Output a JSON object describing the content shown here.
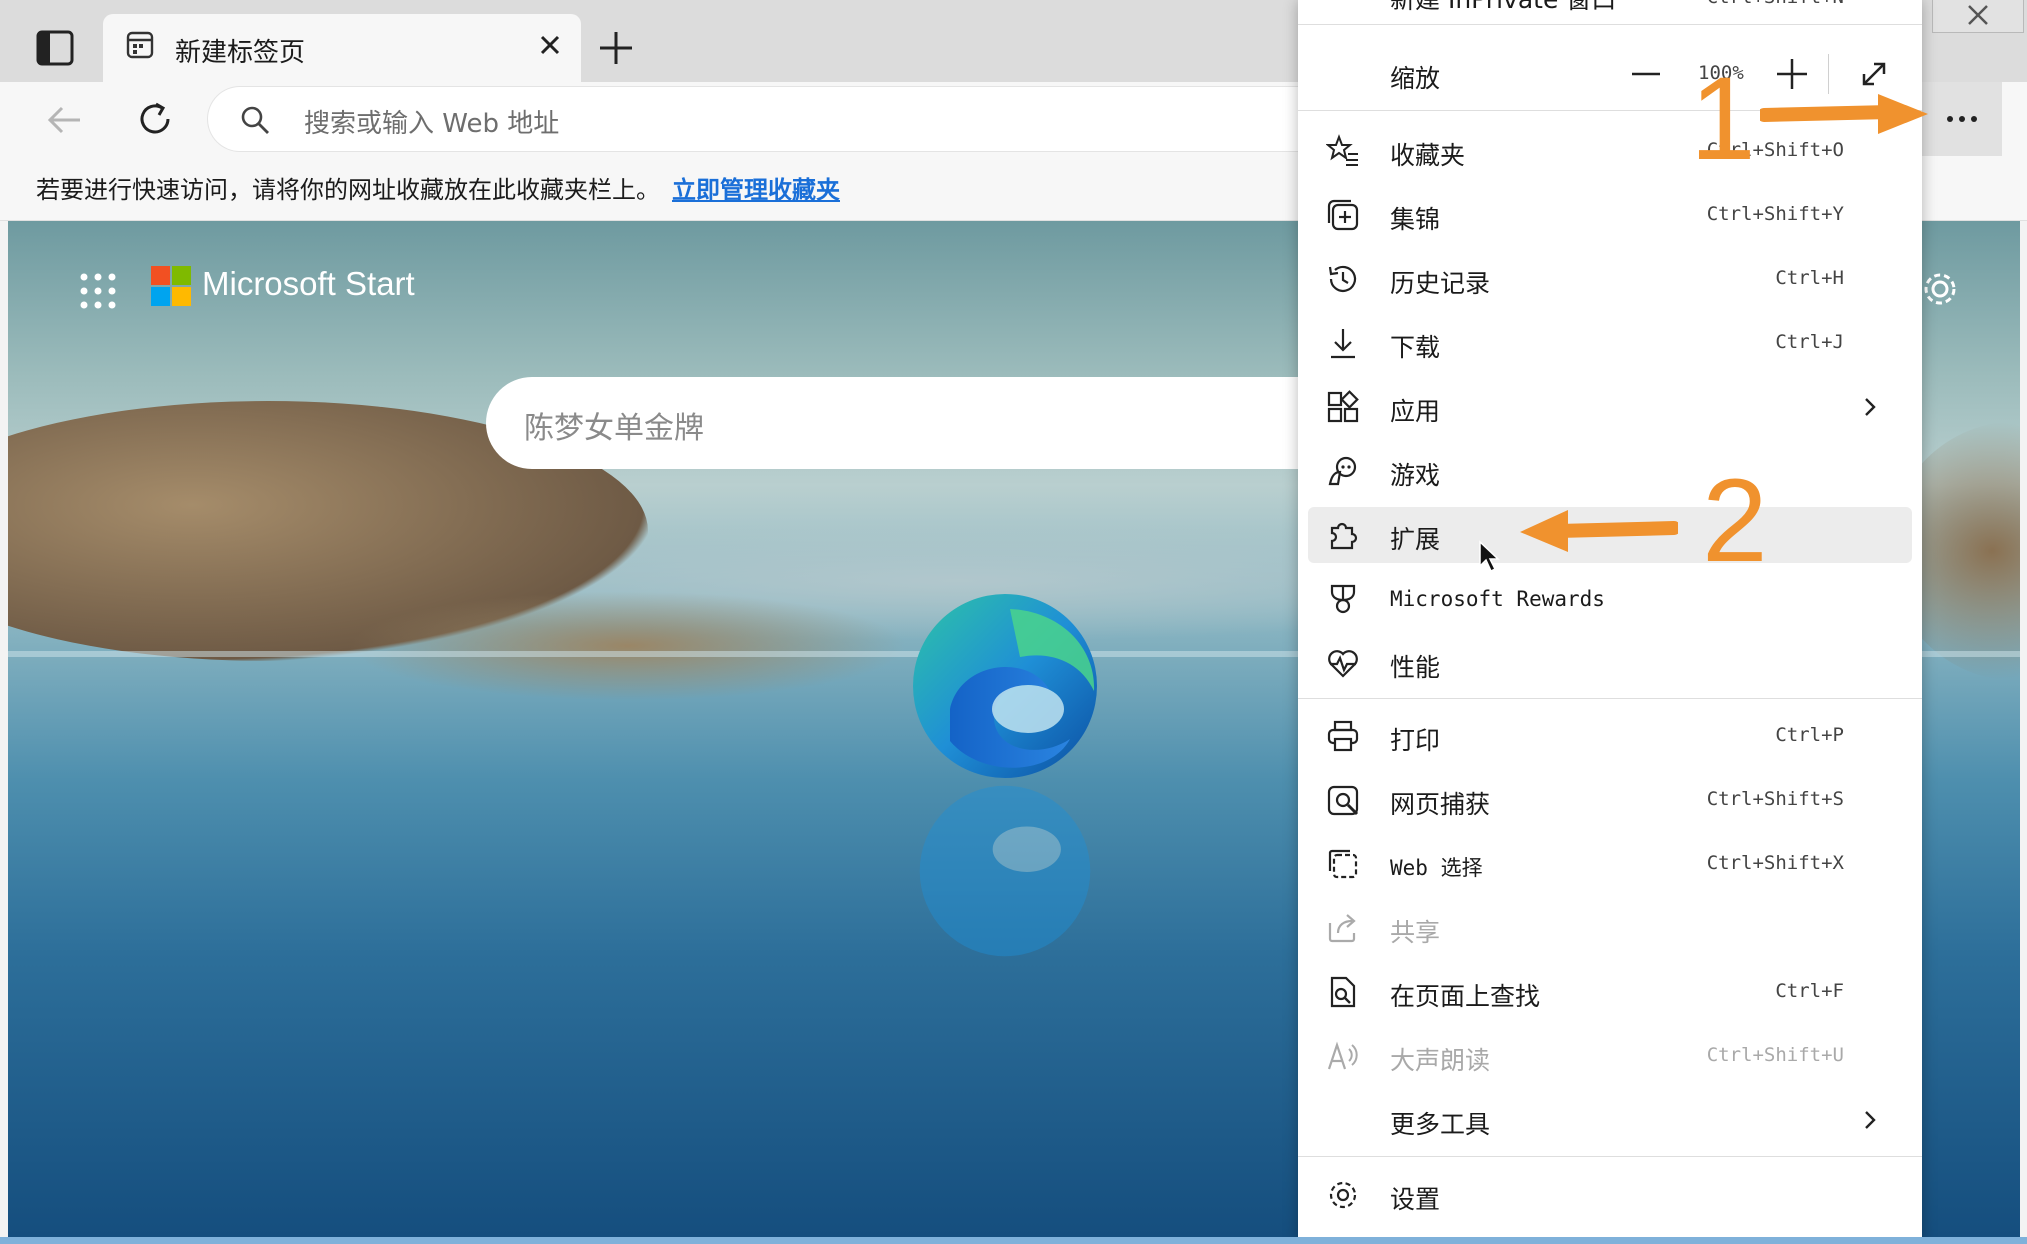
{
  "window": {
    "tab_title": "新建标签页"
  },
  "toolbar": {
    "address_placeholder": "搜索或输入 Web 地址"
  },
  "favorites_bar": {
    "hint": "若要进行快速访问，请将你的网址收藏放在此收藏夹栏上。",
    "manage_link": "立即管理收藏夹"
  },
  "new_tab_page": {
    "brand": "Microsoft Start",
    "search_placeholder": "陈梦女单金牌"
  },
  "menu": {
    "top_partial_label": "新建 InPrivate 窗口",
    "top_partial_shortcut": "Ctrl+Shift+N",
    "zoom": {
      "label": "缩放",
      "value": "100%"
    },
    "items": [
      {
        "label": "收藏夹",
        "shortcut": "Ctrl+Shift+O",
        "icon": "star-list-icon"
      },
      {
        "label": "集锦",
        "shortcut": "Ctrl+Shift+Y",
        "icon": "collections-icon"
      },
      {
        "label": "历史记录",
        "shortcut": "Ctrl+H",
        "icon": "history-icon"
      },
      {
        "label": "下载",
        "shortcut": "Ctrl+J",
        "icon": "download-icon"
      },
      {
        "label": "应用",
        "shortcut": "",
        "icon": "apps-icon",
        "submenu": true
      },
      {
        "label": "游戏",
        "shortcut": "",
        "icon": "games-icon"
      },
      {
        "label": "扩展",
        "shortcut": "",
        "icon": "extensions-icon",
        "highlighted": true
      },
      {
        "label": "Microsoft Rewards",
        "shortcut": "",
        "icon": "rewards-icon"
      },
      {
        "label": "性能",
        "shortcut": "",
        "icon": "performance-icon"
      },
      {
        "label": "打印",
        "shortcut": "Ctrl+P",
        "icon": "print-icon"
      },
      {
        "label": "网页捕获",
        "shortcut": "Ctrl+Shift+S",
        "icon": "web-capture-icon"
      },
      {
        "label": "Web 选择",
        "shortcut": "Ctrl+Shift+X",
        "icon": "web-select-icon"
      },
      {
        "label": "共享",
        "shortcut": "",
        "icon": "share-icon",
        "disabled": true
      },
      {
        "label": "在页面上查找",
        "shortcut": "Ctrl+F",
        "icon": "find-icon"
      },
      {
        "label": "大声朗读",
        "shortcut": "Ctrl+Shift+U",
        "icon": "read-aloud-icon",
        "disabled": true
      },
      {
        "label": "更多工具",
        "shortcut": "",
        "icon": "",
        "submenu": true
      },
      {
        "label": "设置",
        "shortcut": "",
        "icon": "settings-icon"
      }
    ]
  },
  "annotations": {
    "step1": "1",
    "step2": "2"
  },
  "colors": {
    "accent": "#f0922e",
    "link": "#1a6fd8",
    "highlight_row": "#ececec"
  }
}
